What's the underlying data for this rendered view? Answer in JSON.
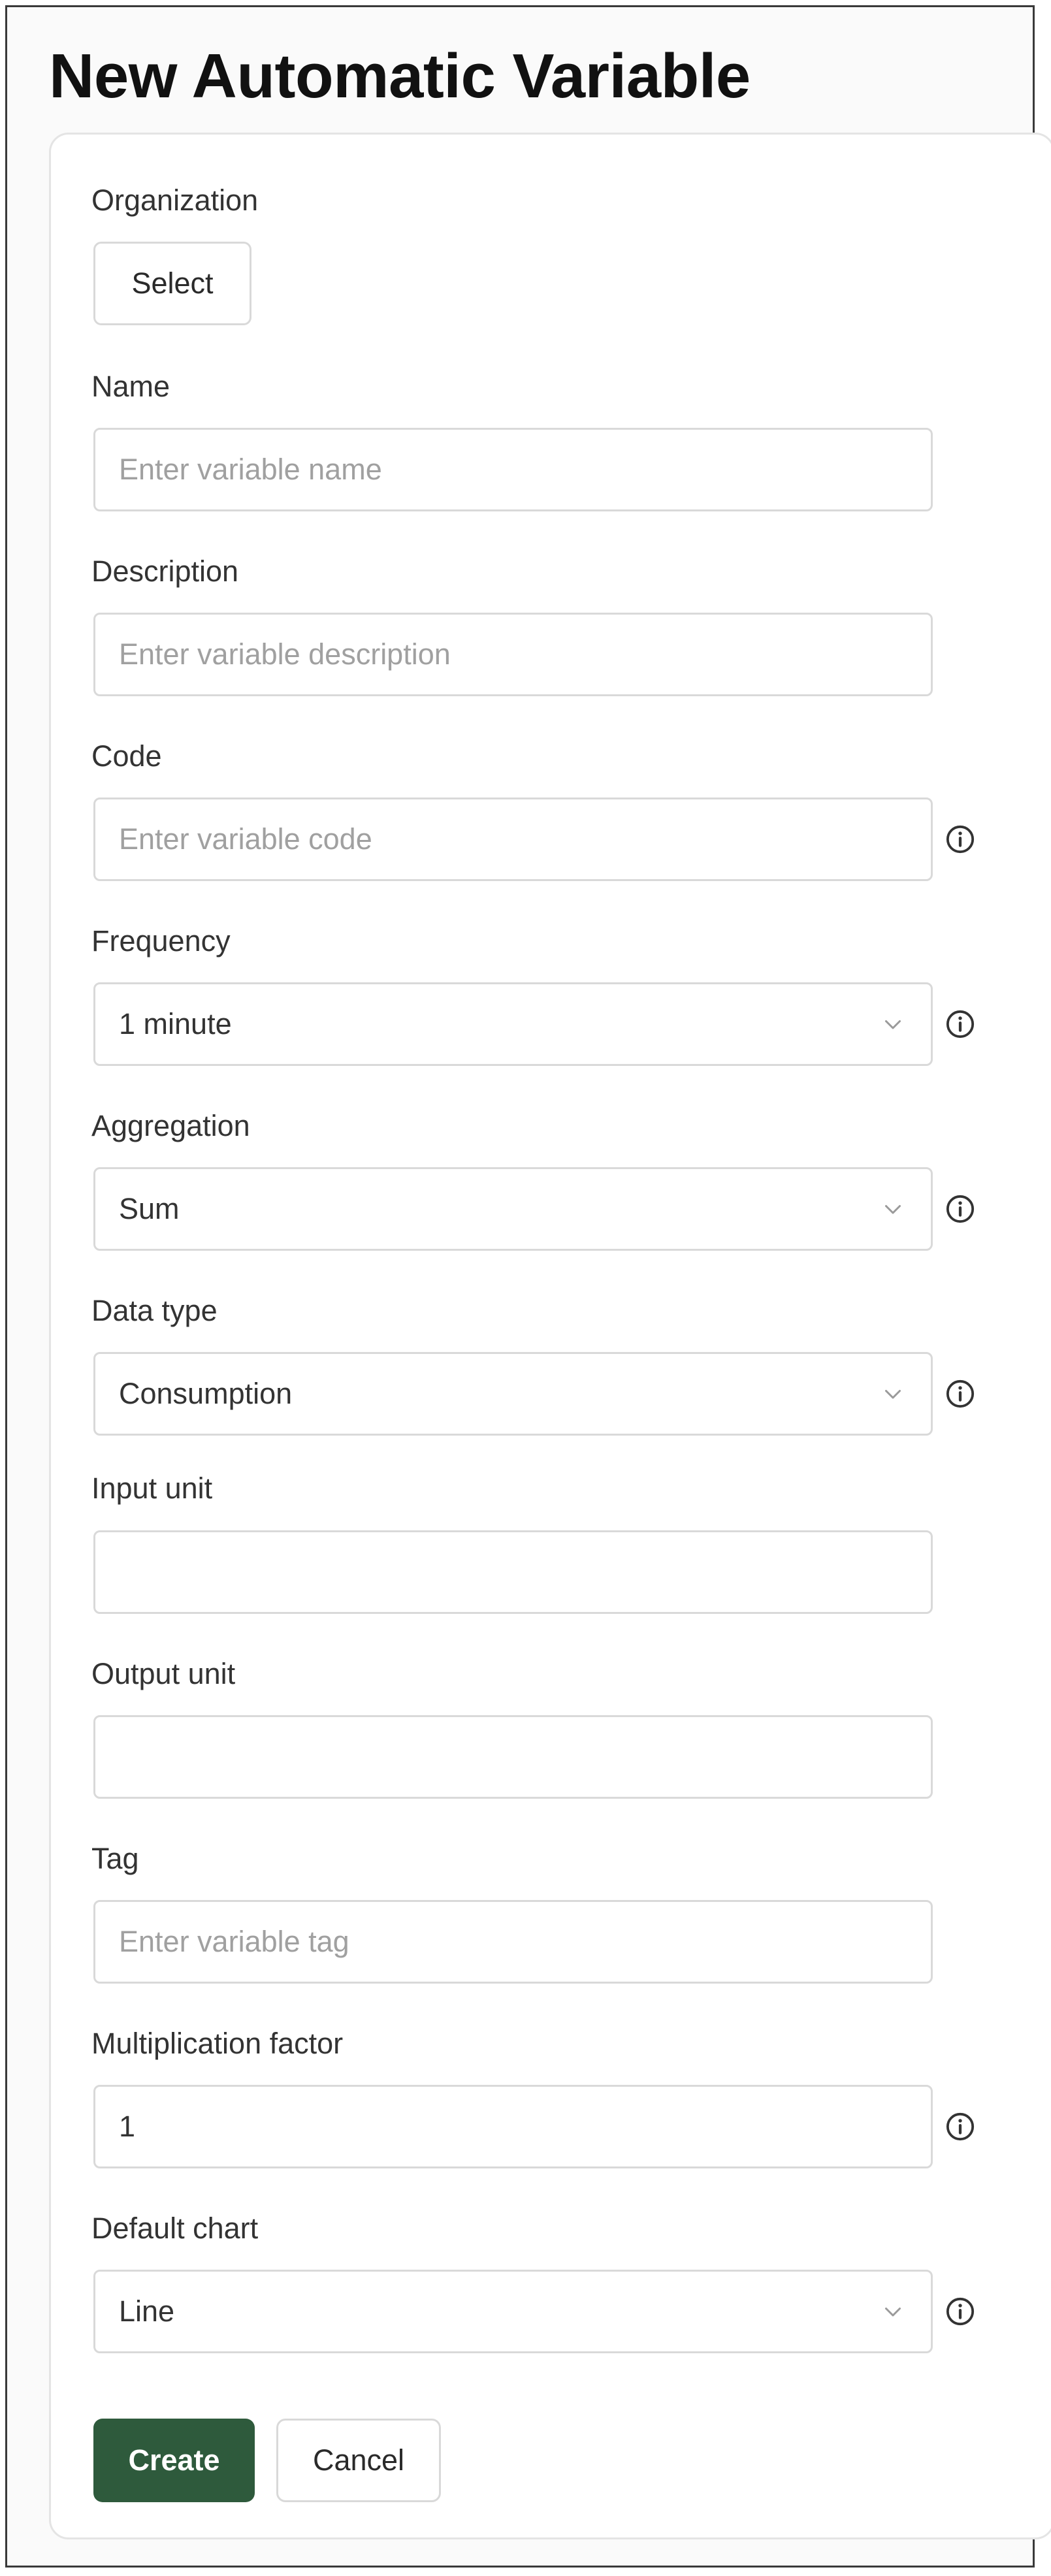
{
  "page": {
    "title": "New Automatic Variable"
  },
  "form": {
    "organization": {
      "label": "Organization",
      "button": "Select"
    },
    "name": {
      "label": "Name",
      "placeholder": "Enter variable name",
      "value": ""
    },
    "description": {
      "label": "Description",
      "placeholder": "Enter variable description",
      "value": ""
    },
    "code": {
      "label": "Code",
      "placeholder": "Enter variable code",
      "value": ""
    },
    "frequency": {
      "label": "Frequency",
      "selected": "1 minute"
    },
    "aggregation": {
      "label": "Aggregation",
      "selected": "Sum"
    },
    "data_type": {
      "label": "Data type",
      "selected": "Consumption"
    },
    "input_unit": {
      "label": "Input unit",
      "value": ""
    },
    "output_unit": {
      "label": "Output unit",
      "value": ""
    },
    "tag": {
      "label": "Tag",
      "placeholder": "Enter variable tag",
      "value": ""
    },
    "multiplication_factor": {
      "label": "Multiplication factor",
      "value": "1"
    },
    "default_chart": {
      "label": "Default chart",
      "selected": "Line"
    }
  },
  "actions": {
    "create": "Create",
    "cancel": "Cancel"
  },
  "colors": {
    "primary_button": "#2e5a3c",
    "border": "#d9d9d9",
    "placeholder": "#a0a0a0"
  },
  "icons": {
    "info": "info-circle-icon",
    "chevron": "chevron-down-icon"
  }
}
